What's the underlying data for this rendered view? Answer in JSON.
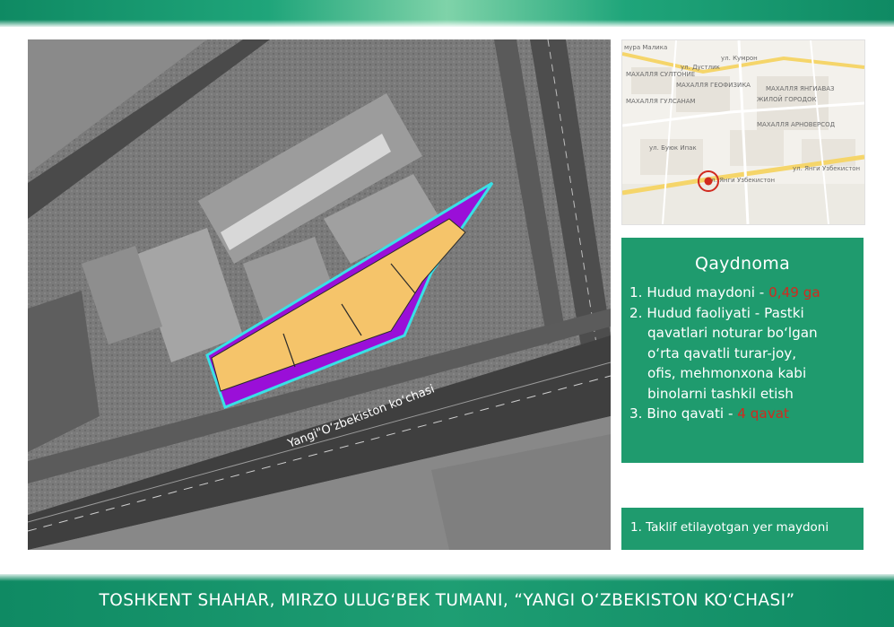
{
  "satellite": {
    "road_label": "Yangi\"O‘zbekiston ko‘chasi"
  },
  "mini_map": {
    "labels": {
      "l1": "мура Малика",
      "l2": "ул. Дустлик",
      "l3": "ул. Кумрон",
      "l4": "МАХАЛЛЯ СУЛТОНИЕ",
      "l5": "МАХАЛЛЯ ГЕОФИЗИКА",
      "l6": "ЖИЛОЙ ГОРОДОК",
      "l7": "МАХАЛЛЯ ГУЛСАНАМ",
      "l8": "МАХАЛЛЯ ЯНГИАВАЗ",
      "l9": "МАХАЛЛЯ АРНОВЕРСОД",
      "l10": "ул. Буюк Ипак",
      "l11": "ул. Янги Узбекистон",
      "l12": "ул. Янги Узбекистон"
    }
  },
  "legend": {
    "title": "Qaydnoma",
    "item1_label": "1. Hudud maydoni - ",
    "item1_value": "0,49 ga",
    "item2_line1": "2. Hudud faoliyati - Pastki",
    "item2_line2": "qavatlari noturar bo‘lgan",
    "item2_line3": "o‘rta qavatli turar-joy,",
    "item2_line4": "ofis, mehmonxona kabi",
    "item2_line5": "binolarni tashkil etish",
    "item3_label": "3. Bino qavati - ",
    "item3_value": "4 qavat"
  },
  "proposal": {
    "label": "1. Taklif etilayotgan yer maydoni"
  },
  "footer": {
    "title": "TOSHKENT SHAHAR, MIRZO ULUG‘BEK TUMANI, “YANGI O‘ZBEKISTON KO‘CHASI”"
  },
  "colors": {
    "brand_green": "#1f9b6e",
    "highlight_red": "#d12a1f",
    "plot_yellow": "#f5c46a",
    "plot_purple": "#9a0fd8",
    "plot_outline": "#39e0e6"
  }
}
